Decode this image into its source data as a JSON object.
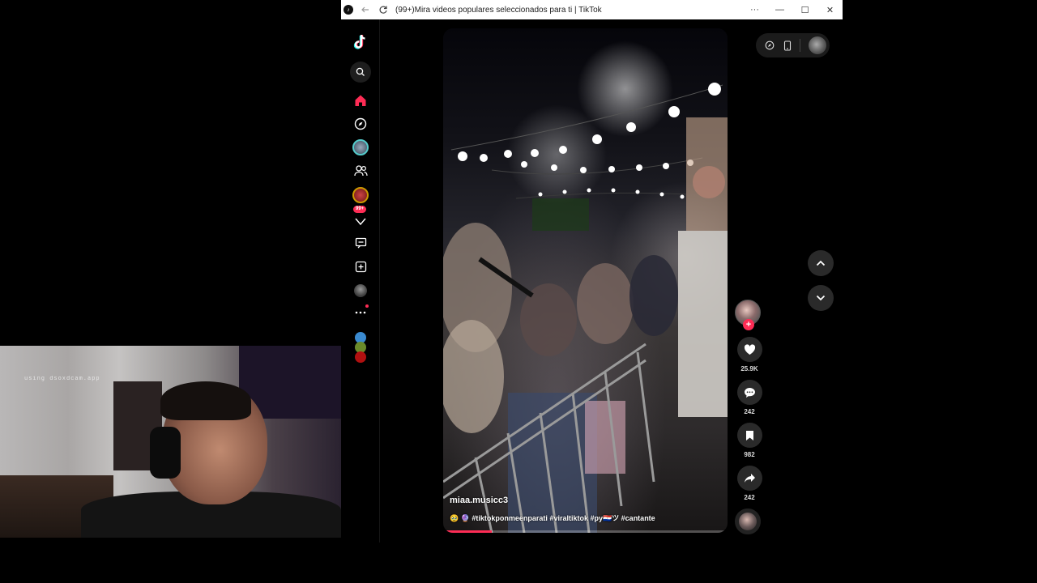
{
  "browser": {
    "title": "(99+)Mira videos populares seleccionados para ti | TikTok",
    "more_label": "···",
    "minimize_label": "—",
    "maximize_label": "☐",
    "close_label": "✕"
  },
  "sidebar": {
    "inbox_badge": "99+"
  },
  "video": {
    "username": "miaa.musicc3",
    "caption": "🥹 🔮 #tiktokponmeenparati #viraltiktok #py🇵🇾ツ #cantante",
    "progress_fraction": 0.17
  },
  "actions": {
    "likes": "25.9K",
    "comments": "242",
    "saves": "982",
    "shares": "242"
  },
  "colors": {
    "accent": "#fe2c55",
    "background": "#000000"
  },
  "webcam": {
    "watermark": "using dsoxdcam.app"
  }
}
